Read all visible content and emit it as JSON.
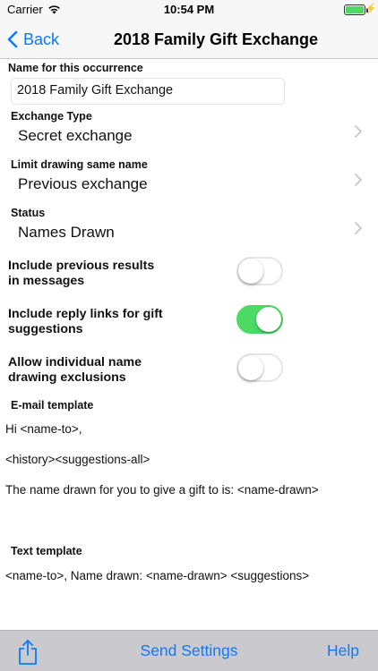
{
  "status_bar": {
    "carrier": "Carrier",
    "time": "10:54 PM",
    "battery_level": 1.0
  },
  "nav": {
    "back_label": "Back",
    "title": "2018 Family Gift Exchange"
  },
  "form": {
    "name_label": "Name for this occurrence",
    "name_value": "2018 Family Gift Exchange",
    "exchange_type_label": "Exchange Type",
    "exchange_type_value": "Secret exchange",
    "limit_label": "Limit drawing same name",
    "limit_value": "Previous exchange",
    "status_label": "Status",
    "status_value": "Names Drawn",
    "toggles": [
      {
        "label_line1": "Include previous results",
        "label_line2": "in messages",
        "on": false
      },
      {
        "label_line1": "Include reply links for gift",
        "label_line2": "suggestions",
        "on": true
      },
      {
        "label_line1": "Allow individual name",
        "label_line2": "drawing exclusions",
        "on": false
      }
    ],
    "email_template_label": "E-mail template",
    "email_template_lines": [
      "Hi <name-to>,",
      "<history><suggestions-all>",
      "The name drawn for you to give a gift to is: <name-drawn>"
    ],
    "text_template_label": "Text template",
    "text_template_value": "<name-to>, Name drawn: <name-drawn> <suggestions>"
  },
  "toolbar": {
    "send_settings_label": "Send Settings",
    "help_label": "Help"
  },
  "colors": {
    "accent": "#0a7aff",
    "switch_on": "#4cd964",
    "toolbar_bg": "#c9c9ce",
    "nav_bg": "#f7f7f7"
  },
  "icons": {
    "wifi": "wifi-icon",
    "battery": "battery-icon",
    "charging": "charging-bolt-icon",
    "back": "chevron-left-icon",
    "disclosure": "chevron-right-icon",
    "share": "share-icon"
  }
}
